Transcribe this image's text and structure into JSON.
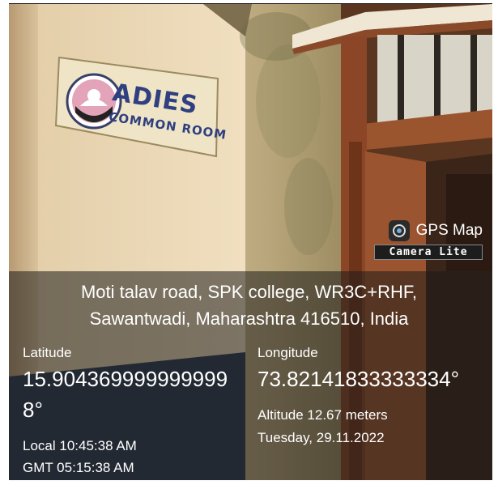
{
  "sign": {
    "line1": "ADIES",
    "line2": "COMMON ROOM"
  },
  "badge": {
    "icon": "camera-lens-icon",
    "title": "GPS Map",
    "subtitle": "Camera Lite"
  },
  "overlay": {
    "address_line1": "Moti talav road, SPK college, WR3C+RHF,",
    "address_line2": "Sawantwadi, Maharashtra 416510, India",
    "latitude_label": "Latitude",
    "latitude_value_line1": "15.904369999999999",
    "latitude_value_line2": "8°",
    "longitude_label": "Longitude",
    "longitude_value": "73.82141833333334°",
    "altitude": "Altitude 12.67 meters",
    "local_time": "Local 10:45:38 AM",
    "gmt_time": "GMT 05:15:38 AM",
    "date": "Tuesday, 29.11.2022"
  },
  "colors": {
    "wall": "#e9d6b4",
    "door": "#8a4a2a",
    "sign_text": "#2f3f80",
    "logo_pink": "#e3a3b8"
  }
}
